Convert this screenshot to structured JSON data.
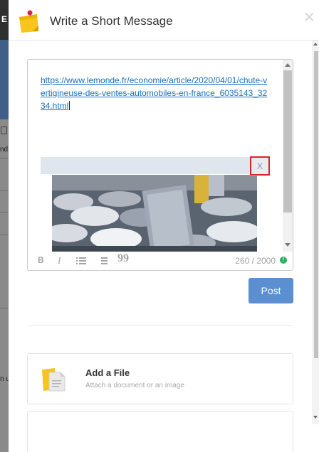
{
  "background": {
    "topbar_letter": "E",
    "side_text_1": "nd",
    "side_text_2": "n u"
  },
  "modal": {
    "title": "Write a Short Message",
    "close_glyph": "✕"
  },
  "composer": {
    "link_url": "https://www.lemonde.fr/economie/article/2020/04/01/chute-vertigineuse-des-ventes-automobiles-en-france_6035143_3234.html",
    "remove_preview_label": "X",
    "toolbar": {
      "bold": "B",
      "italic": "I",
      "quote": "99"
    },
    "char_count": "260 / 2000",
    "status_color": "#27ae60"
  },
  "post_button_label": "Post",
  "attach": {
    "title": "Add a File",
    "subtitle": "Attach a document or an image"
  },
  "colors": {
    "accent": "#5b8fcf",
    "link": "#1a6fb8",
    "highlight_border": "#d9232c"
  },
  "icons": {
    "header": "sticky-note-icon",
    "attach": "file-icon"
  }
}
